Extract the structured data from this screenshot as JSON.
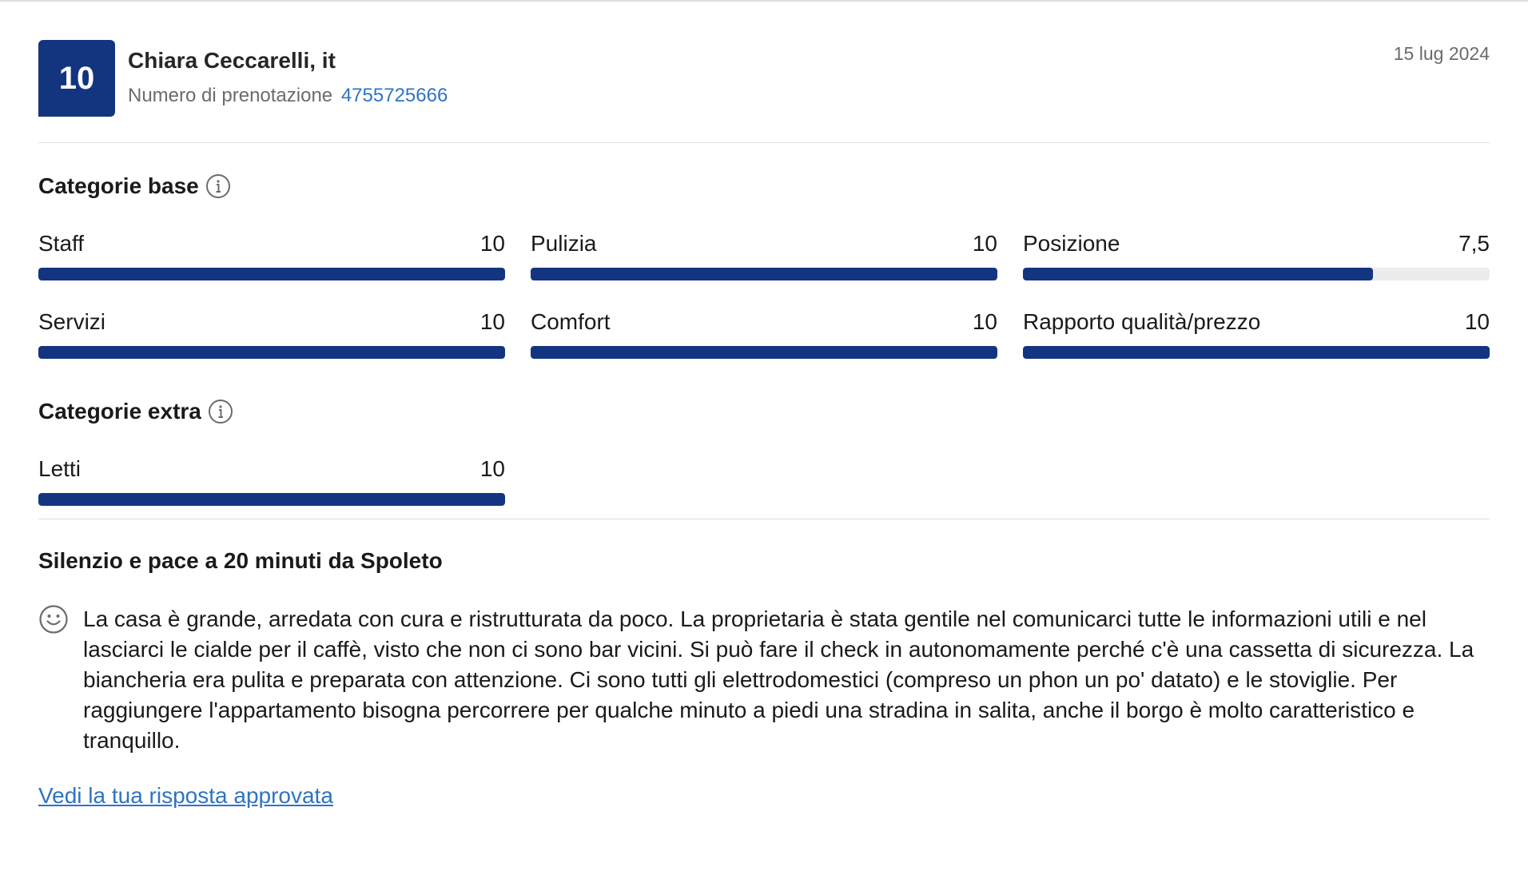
{
  "header": {
    "score": "10",
    "reviewer_name": "Chiara Ceccarelli, it",
    "booking_label": "Numero di prenotazione",
    "booking_number": "4755725666",
    "date": "15 lug 2024"
  },
  "base_section": {
    "title": "Categorie base",
    "categories": [
      {
        "label": "Staff",
        "score": "10",
        "fill_fraction": 1.0
      },
      {
        "label": "Pulizia",
        "score": "10",
        "fill_fraction": 1.0
      },
      {
        "label": "Posizione",
        "score": "7,5",
        "fill_fraction": 0.75
      },
      {
        "label": "Servizi",
        "score": "10",
        "fill_fraction": 1.0
      },
      {
        "label": "Comfort",
        "score": "10",
        "fill_fraction": 1.0
      },
      {
        "label": "Rapporto qualità/prezzo",
        "score": "10",
        "fill_fraction": 1.0
      }
    ]
  },
  "extra_section": {
    "title": "Categorie extra",
    "categories": [
      {
        "label": "Letti",
        "score": "10",
        "fill_fraction": 1.0
      }
    ]
  },
  "review": {
    "title": "Silenzio e pace a 20 minuti da Spoleto",
    "text": "La casa è grande, arredata con cura e ristrutturata da poco. La proprietaria è stata gentile nel comunicarci tutte le informazioni utili e nel lasciarci le cialde per il caffè, visto che non ci sono bar vicini. Si può fare il check in autonomamente perché c'è una cassetta di sicurezza. La biancheria era pulita e preparata con attenzione. Ci sono tutti gli elettrodomestici (compreso un phon un po' datato) e le stoviglie. Per raggiungere l'appartamento bisogna percorrere per qualche minuto a piedi una stradina in salita, anche il borgo è molto caratteristico e tranquillo.",
    "sentiment_icon": "smile-icon"
  },
  "response_link": "Vedi la tua risposta approvata",
  "colors": {
    "brand_blue": "#133580",
    "link_blue": "#2f74c0",
    "bar_track": "#ececec"
  }
}
